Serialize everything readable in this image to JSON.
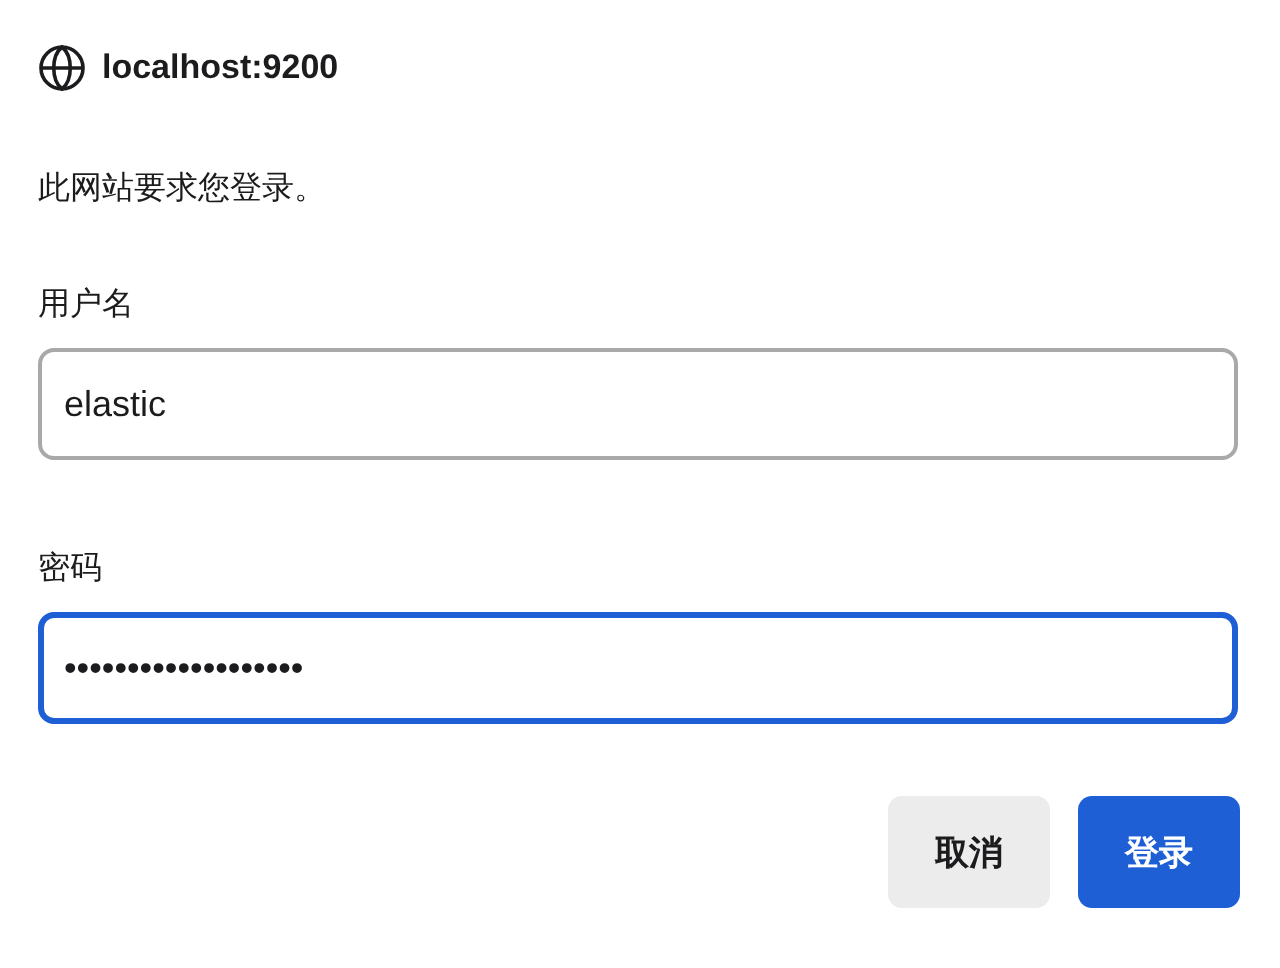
{
  "header": {
    "title": "localhost:9200"
  },
  "message": "此网站要求您登录。",
  "fields": [
    {
      "label": "用户名",
      "value": "elastic",
      "focused": false
    },
    {
      "label": "密码",
      "value": "•••••••••••••••••••",
      "focused": true
    }
  ],
  "buttons": [
    {
      "label": "取消",
      "kind": "secondary"
    },
    {
      "label": "登录",
      "kind": "primary"
    }
  ]
}
